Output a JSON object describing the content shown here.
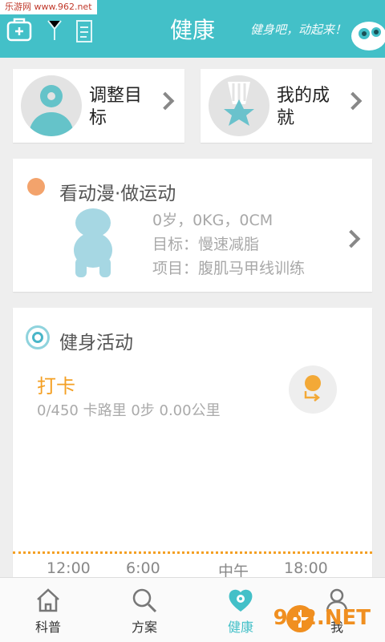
{
  "watermark": {
    "text": "乐游网 www.962.net"
  },
  "header": {
    "title": "健康",
    "slogan": "健身吧，动起来！",
    "bg_color": "#43c0c8"
  },
  "goal_card": {
    "label": "调整目标"
  },
  "achievement_card": {
    "label": "我的成就"
  },
  "anime": {
    "title": "看动漫·做运动",
    "line1": "0岁，0KG，0CM",
    "line2": "目标：慢速减脂",
    "line3": "项目：腹肌马甲线训练"
  },
  "fitness": {
    "title": "健身活动",
    "checkin": "打卡",
    "stats": "0/450 卡路里  0步  0.00公里",
    "times": [
      "12:00",
      "6:00",
      "中午",
      "18:00"
    ]
  },
  "tabs": [
    {
      "label": "科普",
      "icon": "house-icon"
    },
    {
      "label": "方案",
      "icon": "search-magnifier-icon"
    },
    {
      "label": "健康",
      "icon": "heart-icon"
    },
    {
      "label": "我",
      "icon": "profile-icon"
    }
  ],
  "net_watermark": {
    "text": "962.NET"
  }
}
